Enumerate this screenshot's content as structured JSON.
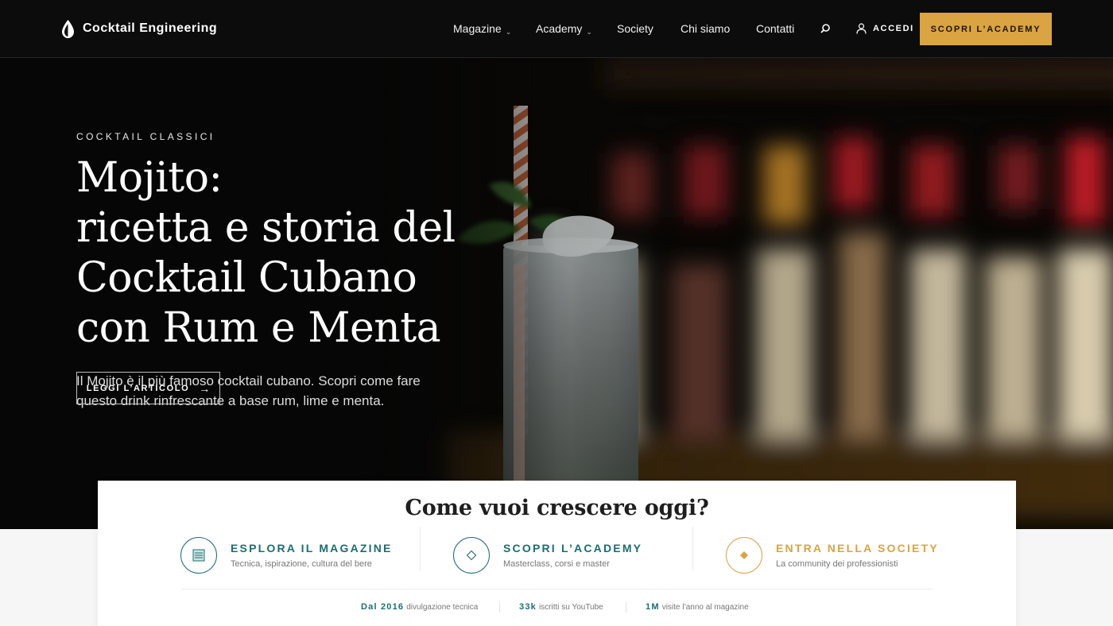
{
  "nav": {
    "brand": "Cocktail Engineering",
    "items": [
      {
        "label": "Magazine",
        "has_dropdown": true
      },
      {
        "label": "Academy",
        "has_dropdown": true
      },
      {
        "label": "Society",
        "has_dropdown": false
      },
      {
        "label": "Chi siamo",
        "has_dropdown": false
      },
      {
        "label": "Contatti",
        "has_dropdown": false
      }
    ],
    "dropdown_glyph": "⌄",
    "search_icon": "search-icon",
    "login_label": "ACCEDI",
    "cta_label": "SCOPRI L’ACADEMY"
  },
  "hero": {
    "kicker": "COCKTAIL CLASSICI",
    "title_lines": [
      "Mojito:",
      "ricetta e storia del",
      "Cocktail Cubano",
      "con Rum e Menta"
    ],
    "description": "Il Mojito è il più famoso cocktail cubano. Scopri come fare questo drink rinfrescante a base rum, lime e menta.",
    "button_label": "LEGGI L’ARTICOLO",
    "button_arrow": "→"
  },
  "growth": {
    "title": "Come vuoi crescere oggi?",
    "options": [
      {
        "label": "ESPLORA IL MAGAZINE",
        "subtitle": "Tecnica, ispirazione, cultura del bere",
        "icon": "book-icon"
      },
      {
        "label": "SCOPRI L’ACADEMY",
        "subtitle": "Masterclass, corsi e master",
        "icon": "diamond-outline-icon"
      },
      {
        "label": "ENTRA NELLA SOCIETY",
        "subtitle": "La community dei professionisti",
        "icon": "diamond-filled-icon"
      }
    ],
    "stats": [
      {
        "value": "Dal 2016",
        "label": "divulgazione tecnica"
      },
      {
        "value": "33k",
        "label": "iscritti su YouTube"
      },
      {
        "value": "1M",
        "label": "visite l’anno al magazine"
      }
    ]
  },
  "colors": {
    "accent_gold": "#d9a441",
    "accent_teal": "#1b6e6e",
    "nav_bg": "#0c0c0c"
  }
}
